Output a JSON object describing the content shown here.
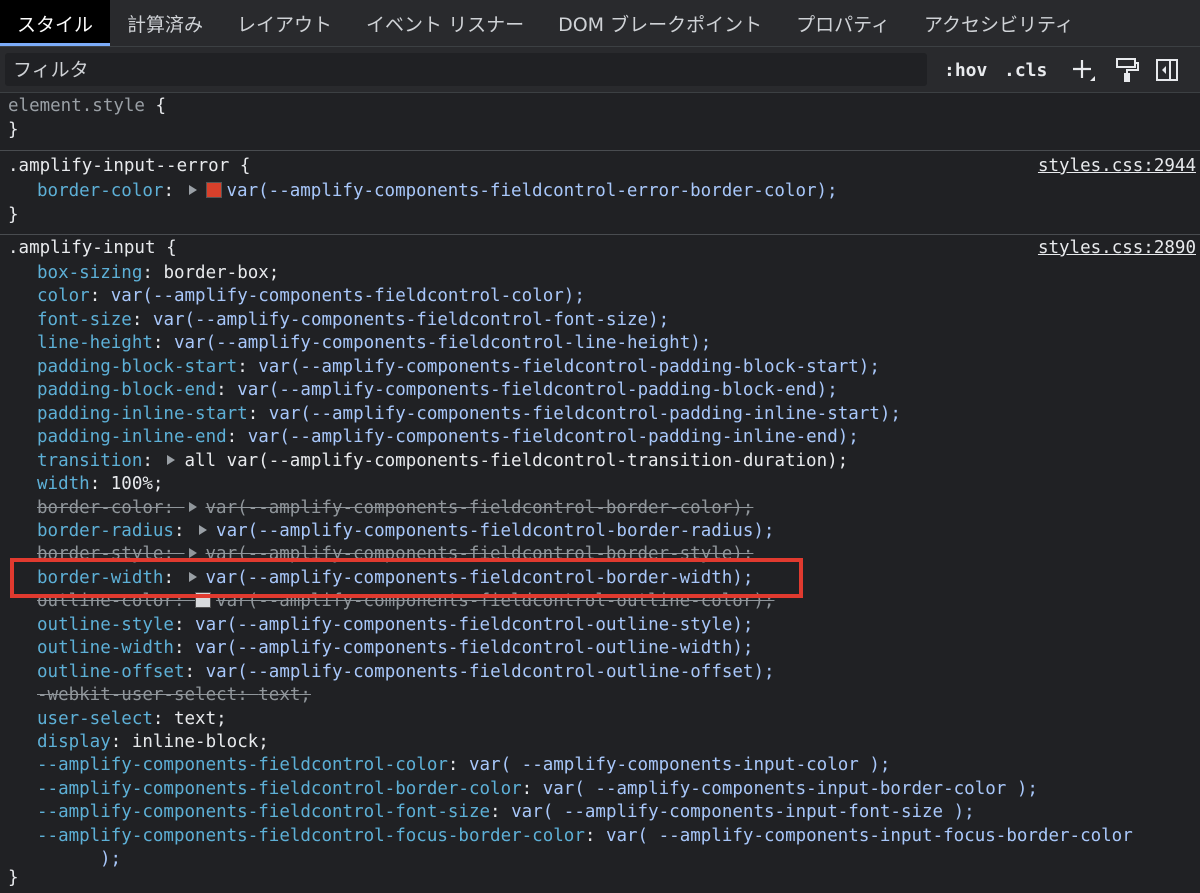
{
  "tabs": [
    {
      "label": "スタイル",
      "active": true
    },
    {
      "label": "計算済み"
    },
    {
      "label": "レイアウト"
    },
    {
      "label": "イベント リスナー"
    },
    {
      "label": "DOM ブレークポイント"
    },
    {
      "label": "プロパティ"
    },
    {
      "label": "アクセシビリティ"
    }
  ],
  "filter": {
    "placeholder": "フィルタ"
  },
  "toolbar": {
    "hov": ":hov",
    "cls": ".cls",
    "add_icon": "plus-icon",
    "paint_icon": "paint-roller-icon",
    "sidebar_icon": "sidebar-toggle-icon"
  },
  "element_style": {
    "selector": "element.style",
    "open": "{",
    "close": "}"
  },
  "rule_error": {
    "selector": ".amplify-input--error",
    "source": "styles.css:2944",
    "decl": {
      "prop": "border-color",
      "value": "var(--amplify-components-fieldcontrol-error-border-color);",
      "swatch": "#d7402b"
    }
  },
  "rule_input": {
    "selector": ".amplify-input",
    "source": "styles.css:2890",
    "decls": [
      {
        "prop": "box-sizing",
        "value": "border-box;"
      },
      {
        "prop": "color",
        "value": "var(--amplify-components-fieldcontrol-color);"
      },
      {
        "prop": "font-size",
        "value": "var(--amplify-components-fieldcontrol-font-size);"
      },
      {
        "prop": "line-height",
        "value": "var(--amplify-components-fieldcontrol-line-height);"
      },
      {
        "prop": "padding-block-start",
        "value": "var(--amplify-components-fieldcontrol-padding-block-start);"
      },
      {
        "prop": "padding-block-end",
        "value": "var(--amplify-components-fieldcontrol-padding-block-end);"
      },
      {
        "prop": "padding-inline-start",
        "value": "var(--amplify-components-fieldcontrol-padding-inline-start);"
      },
      {
        "prop": "padding-inline-end",
        "value": "var(--amplify-components-fieldcontrol-padding-inline-end);"
      },
      {
        "prop": "transition",
        "value": "all var(--amplify-components-fieldcontrol-transition-duration);",
        "tri": true
      },
      {
        "prop": "width",
        "value": "100%;"
      },
      {
        "prop": "border-color",
        "value": "var(--amplify-components-fieldcontrol-border-color);",
        "tri": true,
        "strike": true
      },
      {
        "prop": "border-radius",
        "value": "var(--amplify-components-fieldcontrol-border-radius);",
        "tri": true
      },
      {
        "prop": "border-style",
        "value": "var(--amplify-components-fieldcontrol-border-style);",
        "tri": true,
        "strike": true
      },
      {
        "prop": "border-width",
        "value": "var(--amplify-components-fieldcontrol-border-width);",
        "tri": true
      },
      {
        "prop": "outline-color",
        "value": "var(--amplify-components-fieldcontrol-outline-color);",
        "swatch": "#e8eaed",
        "strike": true
      },
      {
        "prop": "outline-style",
        "value": "var(--amplify-components-fieldcontrol-outline-style);"
      },
      {
        "prop": "outline-width",
        "value": "var(--amplify-components-fieldcontrol-outline-width);"
      },
      {
        "prop": "outline-offset",
        "value": "var(--amplify-components-fieldcontrol-outline-offset);"
      },
      {
        "prop": "-webkit-user-select",
        "value": "text;",
        "strike": true
      },
      {
        "prop": "user-select",
        "value": "text;"
      },
      {
        "prop": "display",
        "value": "inline-block;"
      },
      {
        "prop": "--amplify-components-fieldcontrol-color",
        "value": "var( --amplify-components-input-color );"
      },
      {
        "prop": "--amplify-components-fieldcontrol-border-color",
        "value": "var( --amplify-components-input-border-color );"
      },
      {
        "prop": "--amplify-components-fieldcontrol-font-size",
        "value": "var( --amplify-components-input-font-size );"
      },
      {
        "prop": "--amplify-components-fieldcontrol-focus-border-color",
        "value": "var( --amplify-components-input-focus-border-color"
      },
      {
        "prop": "",
        "value": ");",
        "wrap": true
      }
    ]
  },
  "colors": {
    "highlight": "#e03a2f",
    "prop": "#5db0d7",
    "var": "#a8c7fa"
  }
}
